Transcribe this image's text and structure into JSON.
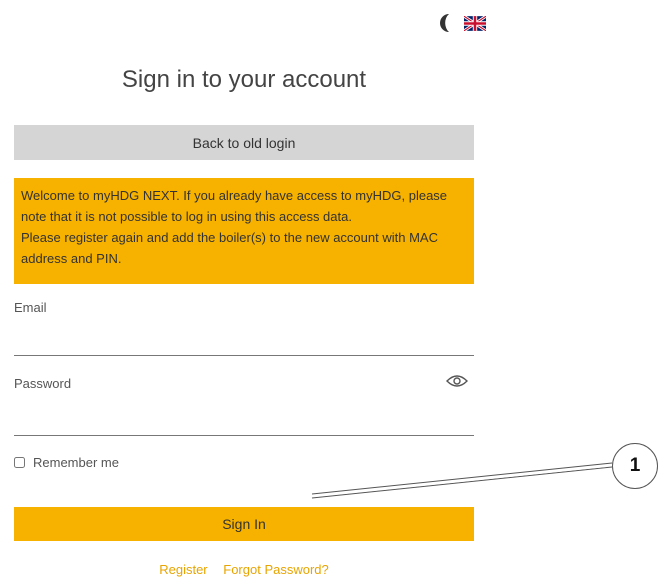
{
  "header": {
    "title": "Sign in to your account",
    "theme_toggle_icon": "moon-icon",
    "language_icon": "uk-flag-icon"
  },
  "old_login_button": "Back to old login",
  "notice": {
    "line1": "Welcome to myHDG NEXT. If you already have access to myHDG, please note that it is not possible to log in using this access data.",
    "line2": "Please register again and add the boiler(s) to the new account with MAC address and PIN."
  },
  "form": {
    "email_label": "Email",
    "email_value": "",
    "password_label": "Password",
    "password_value": "",
    "show_password_icon": "eye-icon",
    "remember_label": "Remember me",
    "remember_checked": false,
    "signin_label": "Sign In"
  },
  "links": {
    "register": "Register",
    "forgot": "Forgot Password?"
  },
  "callout": {
    "number": "1"
  },
  "colors": {
    "accent": "#f7b200",
    "link": "#e8a400",
    "old_login_bg": "#d5d5d5"
  }
}
